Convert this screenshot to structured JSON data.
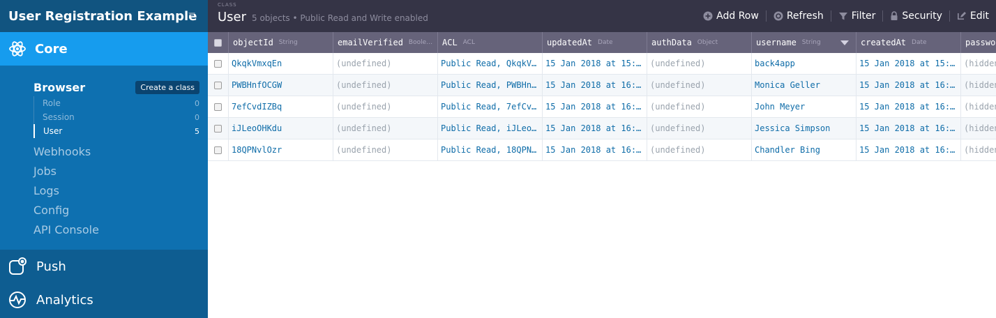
{
  "app": {
    "title": "User Registration Example"
  },
  "sidebar": {
    "core_label": "Core",
    "browser_label": "Browser",
    "create_class_label": "Create a class",
    "classes": [
      {
        "name": "Role",
        "count": "0"
      },
      {
        "name": "Session",
        "count": "0"
      },
      {
        "name": "User",
        "count": "5"
      }
    ],
    "nav": [
      "Webhooks",
      "Jobs",
      "Logs",
      "Config",
      "API Console"
    ],
    "bottom": [
      {
        "label": "Push",
        "icon": "push-icon"
      },
      {
        "label": "Analytics",
        "icon": "analytics-icon"
      }
    ]
  },
  "toolbar": {
    "caption": "CLASS",
    "class_name": "User",
    "meta": "5 objects • Public Read and Write enabled",
    "actions": {
      "add_row": "Add Row",
      "refresh": "Refresh",
      "filter": "Filter",
      "security": "Security",
      "edit": "Edit"
    }
  },
  "table": {
    "columns": [
      {
        "name": "objectId",
        "type": "String"
      },
      {
        "name": "emailVerified",
        "type": "Boole…"
      },
      {
        "name": "ACL",
        "type": "ACL"
      },
      {
        "name": "updatedAt",
        "type": "Date"
      },
      {
        "name": "authData",
        "type": "Object"
      },
      {
        "name": "username",
        "type": "String"
      },
      {
        "name": "createdAt",
        "type": "Date"
      },
      {
        "name": "passwo",
        "type": ""
      }
    ],
    "rows": [
      [
        "QkqkVmxqEn",
        "(undefined)",
        "Public Read, QkqkV…",
        "15 Jan 2018 at 15:…",
        "(undefined)",
        "back4app",
        "15 Jan 2018 at 15:…",
        "(hidden"
      ],
      [
        "PWBHnfOCGW",
        "(undefined)",
        "Public Read, PWBHn…",
        "15 Jan 2018 at 16:…",
        "(undefined)",
        "Monica Geller",
        "15 Jan 2018 at 16:…",
        "(hidden"
      ],
      [
        "7efCvdIZBq",
        "(undefined)",
        "Public Read, 7efCv…",
        "15 Jan 2018 at 16:…",
        "(undefined)",
        "John Meyer",
        "15 Jan 2018 at 16:…",
        "(hidden"
      ],
      [
        "iJLeoOHKdu",
        "(undefined)",
        "Public Read, iJLeo…",
        "15 Jan 2018 at 16:…",
        "(undefined)",
        "Jessica Simpson",
        "15 Jan 2018 at 16:…",
        "(hidden"
      ],
      [
        "18QPNvlOzr",
        "(undefined)",
        "Public Read, 18QPN…",
        "15 Jan 2018 at 16:…",
        "(undefined)",
        "Chandler Bing",
        "15 Jan 2018 at 16:…",
        "(hidden"
      ]
    ]
  }
}
